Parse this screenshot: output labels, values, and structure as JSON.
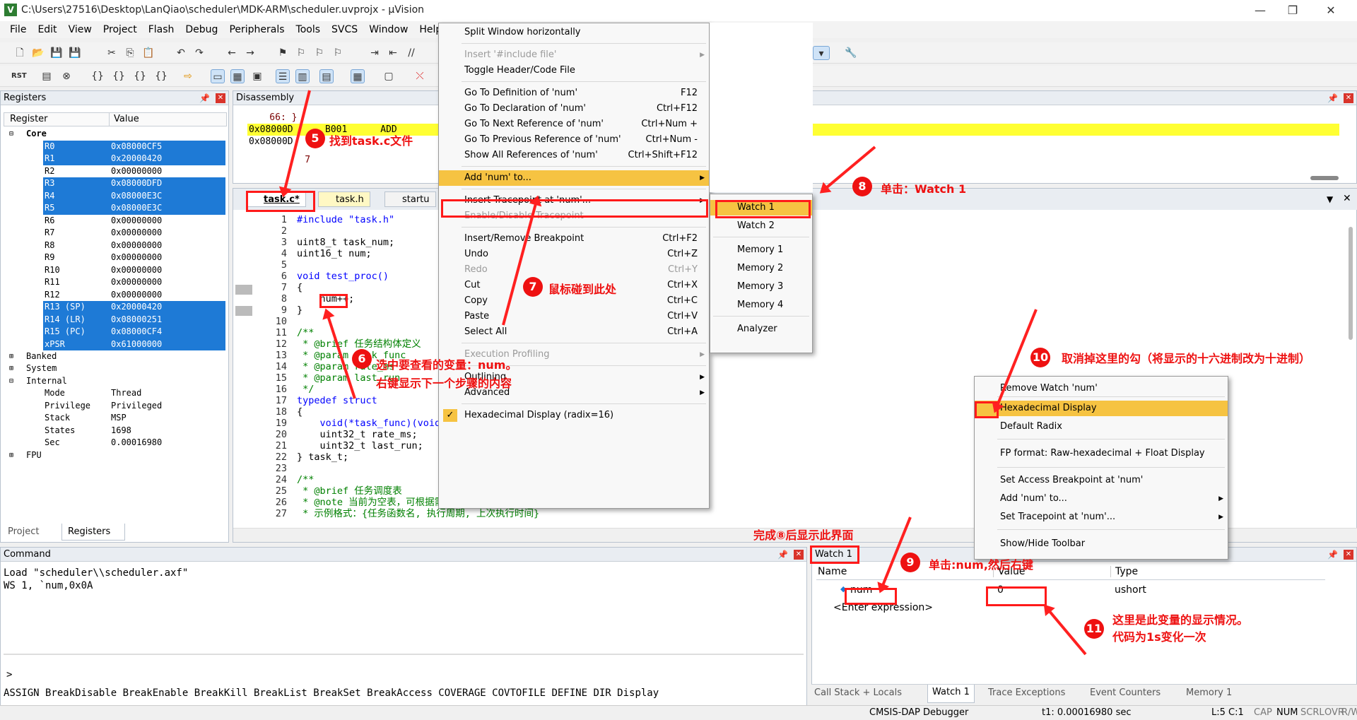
{
  "window": {
    "title": "C:\\Users\\27516\\Desktop\\LanQiao\\scheduler\\MDK-ARM\\scheduler.uvprojx - µVision"
  },
  "menubar": [
    "File",
    "Edit",
    "View",
    "Project",
    "Flash",
    "Debug",
    "Peripherals",
    "Tools",
    "SVCS",
    "Window",
    "Help"
  ],
  "registers": {
    "title": "Registers",
    "col_register": "Register",
    "col_value": "Value",
    "core": "Core",
    "rows": [
      {
        "n": "R0",
        "v": "0x08000CF5",
        "sel": true
      },
      {
        "n": "R1",
        "v": "0x20000420",
        "sel": true
      },
      {
        "n": "R2",
        "v": "0x00000000",
        "sel": false
      },
      {
        "n": "R3",
        "v": "0x08000DFD",
        "sel": true
      },
      {
        "n": "R4",
        "v": "0x08000E3C",
        "sel": true
      },
      {
        "n": "R5",
        "v": "0x08000E3C",
        "sel": true
      },
      {
        "n": "R6",
        "v": "0x00000000",
        "sel": false
      },
      {
        "n": "R7",
        "v": "0x00000000",
        "sel": false
      },
      {
        "n": "R8",
        "v": "0x00000000",
        "sel": false
      },
      {
        "n": "R9",
        "v": "0x00000000",
        "sel": false
      },
      {
        "n": "R10",
        "v": "0x00000000",
        "sel": false
      },
      {
        "n": "R11",
        "v": "0x00000000",
        "sel": false
      },
      {
        "n": "R12",
        "v": "0x00000000",
        "sel": false
      },
      {
        "n": "R13 (SP)",
        "v": "0x20000420",
        "sel": true
      },
      {
        "n": "R14 (LR)",
        "v": "0x08000251",
        "sel": true
      },
      {
        "n": "R15 (PC)",
        "v": "0x08000CF4",
        "sel": true
      },
      {
        "n": "xPSR",
        "v": "0x61000000",
        "sel": true
      }
    ],
    "banked": "Banked",
    "system": "System",
    "internal": "Internal",
    "internal_rows": [
      {
        "n": "Mode",
        "v": "Thread"
      },
      {
        "n": "Privilege",
        "v": "Privileged"
      },
      {
        "n": "Stack",
        "v": "MSP"
      },
      {
        "n": "States",
        "v": "1698"
      },
      {
        "n": "Sec",
        "v": "0.00016980"
      }
    ],
    "fpu": "FPU",
    "tab_project": "Project",
    "tab_registers": "Registers"
  },
  "disassembly": {
    "title": "Disassembly",
    "l1": "    66: }",
    "l2": "0x08000D",
    "l2b": "B001      ADD",
    "l3": "0x08000D",
    "l4": "    7"
  },
  "tabs": [
    "task.c*",
    "task.h",
    "startu"
  ],
  "code": [
    {
      "n": "1",
      "t": "#include \"task.h\""
    },
    {
      "n": "2",
      "t": ""
    },
    {
      "n": "3",
      "t": "uint8_t task_num;"
    },
    {
      "n": "4",
      "t": "uint16_t num;"
    },
    {
      "n": "5",
      "t": ""
    },
    {
      "n": "6",
      "t": "void test_proc()"
    },
    {
      "n": "7",
      "t": "{"
    },
    {
      "n": "8",
      "t": "    num++;"
    },
    {
      "n": "9",
      "t": "}"
    },
    {
      "n": "10",
      "t": ""
    },
    {
      "n": "11",
      "t": "/**"
    },
    {
      "n": "12",
      "t": " * @brief 任务结构体定义"
    },
    {
      "n": "13",
      "t": " * @param task_func"
    },
    {
      "n": "14",
      "t": " * @param rate_ms"
    },
    {
      "n": "15",
      "t": " * @param last_run"
    },
    {
      "n": "16",
      "t": " */"
    },
    {
      "n": "17",
      "t": "typedef struct"
    },
    {
      "n": "18",
      "t": "{"
    },
    {
      "n": "19",
      "t": "    void(*task_func)(void);"
    },
    {
      "n": "20",
      "t": "    uint32_t rate_ms;"
    },
    {
      "n": "21",
      "t": "    uint32_t last_run;"
    },
    {
      "n": "22",
      "t": "} task_t;"
    },
    {
      "n": "23",
      "t": ""
    },
    {
      "n": "24",
      "t": "/**"
    },
    {
      "n": "25",
      "t": " * @brief 任务调度表"
    },
    {
      "n": "26",
      "t": " * @note 当前为空表，可根据需要添加任务"
    },
    {
      "n": "27",
      "t": " * 示例格式：{任务函数名, 执行周期, 上次执行时间}"
    }
  ],
  "context_menu": {
    "items": [
      {
        "l": "Split Window horizontally",
        "k": ""
      },
      {
        "l": "Insert '#include file'",
        "k": "",
        "dis": true,
        "sub": true
      },
      {
        "l": "Toggle Header/Code File",
        "k": ""
      },
      {
        "l": "Go To Definition of 'num'",
        "k": "F12"
      },
      {
        "l": "Go To Declaration of 'num'",
        "k": "Ctrl+F12"
      },
      {
        "l": "Go To Next Reference of 'num'",
        "k": "Ctrl+Num +"
      },
      {
        "l": "Go To Previous Reference of 'num'",
        "k": "Ctrl+Num -"
      },
      {
        "l": "Show All References of 'num'",
        "k": "Ctrl+Shift+F12"
      },
      {
        "l": "Add 'num' to...",
        "k": "",
        "sub": true
      },
      {
        "l": "Insert Tracepoint at 'num'...",
        "k": "",
        "sub": true
      },
      {
        "l": "Enable/Disable Tracepoint",
        "k": "",
        "dis": true
      },
      {
        "l": "Insert/Remove Breakpoint",
        "k": "Ctrl+F2"
      },
      {
        "l": "Undo",
        "k": "Ctrl+Z"
      },
      {
        "l": "Redo",
        "k": "Ctrl+Y",
        "dis": true
      },
      {
        "l": "Cut",
        "k": "Ctrl+X"
      },
      {
        "l": "Copy",
        "k": "Ctrl+C"
      },
      {
        "l": "Paste",
        "k": "Ctrl+V"
      },
      {
        "l": "Select All",
        "k": "Ctrl+A"
      },
      {
        "l": "Execution Profiling",
        "k": "",
        "dis": true,
        "sub": true
      },
      {
        "l": "Outlining",
        "k": "",
        "sub": true
      },
      {
        "l": "Advanced",
        "k": "",
        "sub": true
      },
      {
        "l": "Hexadecimal Display (radix=16)",
        "k": ""
      }
    ]
  },
  "submenu": {
    "items": [
      "Watch 1",
      "Watch 2",
      "Memory 1",
      "Memory 2",
      "Memory 3",
      "Memory 4",
      "Analyzer"
    ]
  },
  "watch_menu": {
    "items": [
      "Remove Watch 'num'",
      "Hexadecimal Display",
      "Default Radix",
      "FP format: Raw-hexadecimal + Float Display",
      "Set Access Breakpoint at 'num'",
      "Add 'num' to...",
      "Set Tracepoint at 'num'...",
      "Show/Hide Toolbar"
    ]
  },
  "command": {
    "title": "Command",
    "l1": "Load \"scheduler\\\\scheduler.axf\"",
    "l2": "WS 1, `num,0x0A",
    "prompt": ">",
    "keywords": "ASSIGN BreakDisable BreakEnable BreakKill BreakList BreakSet BreakAccess COVERAGE COVTOFILE DEFINE DIR Display"
  },
  "watch": {
    "title": "Watch 1",
    "col_name": "Name",
    "col_value": "Value",
    "col_type": "Type",
    "var_name": "num",
    "var_value": "0",
    "var_type": "ushort",
    "enter": "<Enter expression>",
    "tabs": [
      "Call Stack + Locals",
      "Watch 1",
      "Trace Exceptions",
      "Event Counters",
      "Memory 1"
    ]
  },
  "status": {
    "debugger": "CMSIS-DAP Debugger",
    "time": "t1: 0.00016980 sec",
    "pos": "L:5 C:1",
    "caps": "CAP",
    "num": "NUM",
    "scrl": "SCRL",
    "ovr": "OVR",
    "rw": "R/W"
  },
  "annotations": {
    "n5": "5",
    "a5": "找到task.c文件",
    "n6": "6",
    "a6": "选中要查看的变量：num。\n右键显示下一个步骤的内容",
    "n7": "7",
    "a7": "鼠标碰到此处",
    "n8": "8",
    "a8": "单击：Watch 1",
    "n9": "9",
    "a9": "单击:num,然后右键",
    "n10": "10",
    "a10": "取消掉这里的勾（将显示的十六进制改为十进制）",
    "n11": "11",
    "a11": "这里是此变量的显示情况。\n代码为1s变化一次",
    "done8": "完成⑧后显示此界面"
  }
}
